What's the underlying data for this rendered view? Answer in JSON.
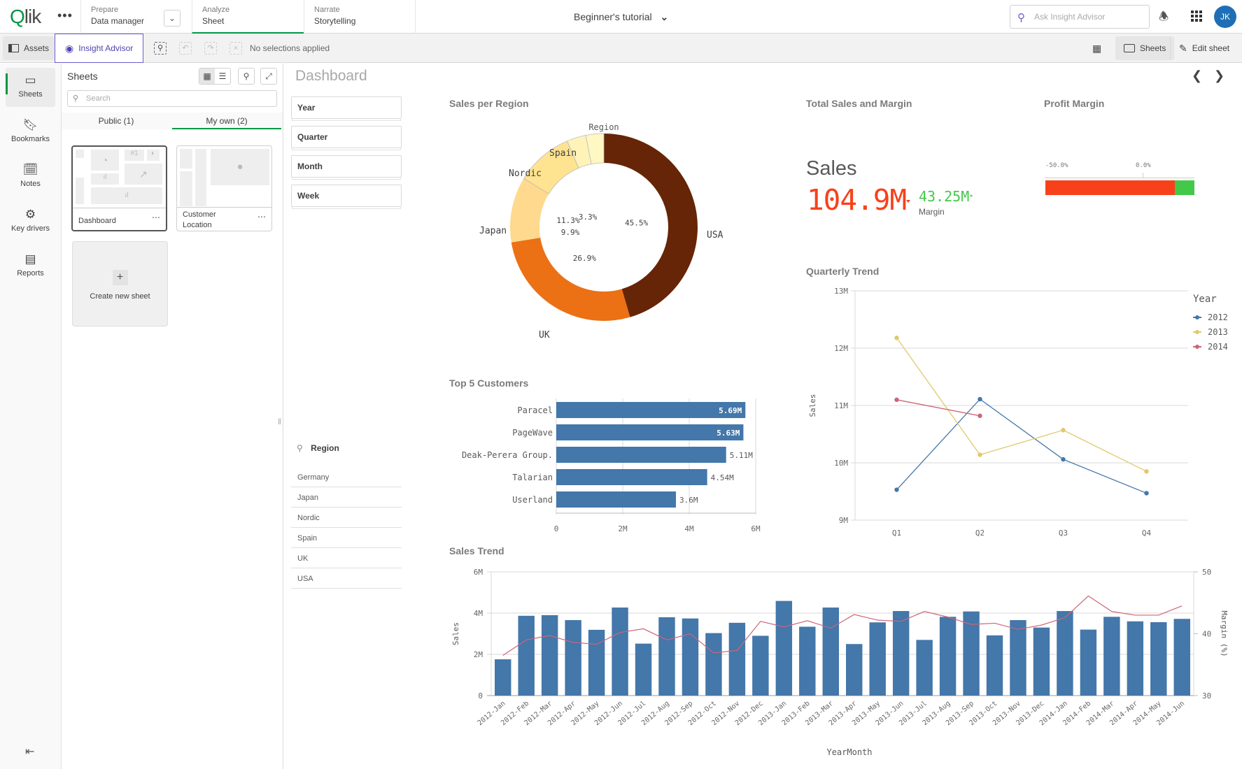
{
  "topbar": {
    "logo": "Qlik",
    "more_label": "•••",
    "nav": [
      {
        "small": "Prepare",
        "big": "Data manager"
      },
      {
        "small": "Analyze",
        "big": "Sheet",
        "active": true
      },
      {
        "small": "Narrate",
        "big": "Storytelling"
      }
    ],
    "app_title": "Beginner's tutorial",
    "search_placeholder": "Ask Insight Advisor",
    "avatar_initials": "JK"
  },
  "toolbar": {
    "assets_label": "Assets",
    "insight_label": "Insight Advisor",
    "no_selections": "No selections applied",
    "sheets_label": "Sheets",
    "edit_label": "Edit sheet"
  },
  "rail": {
    "items": [
      {
        "label": "Sheets",
        "icon": "sheets-icon",
        "active": true
      },
      {
        "label": "Bookmarks",
        "icon": "bookmark-icon"
      },
      {
        "label": "Notes",
        "icon": "notes-icon"
      },
      {
        "label": "Key drivers",
        "icon": "key-drivers-icon"
      },
      {
        "label": "Reports",
        "icon": "reports-icon"
      }
    ]
  },
  "panel": {
    "title": "Sheets",
    "search_placeholder": "Search",
    "tabs": [
      {
        "label": "Public (1)"
      },
      {
        "label": "My own (2)",
        "active": true
      }
    ],
    "cards": [
      {
        "label": "Dashboard",
        "selected": true
      },
      {
        "label": "Customer Location"
      }
    ],
    "create_label": "Create new sheet"
  },
  "main": {
    "title": "Dashboard",
    "filters": [
      "Year",
      "Quarter",
      "Month",
      "Week"
    ],
    "region_filter": {
      "title": "Region",
      "items": [
        "Germany",
        "Japan",
        "Nordic",
        "Spain",
        "UK",
        "USA"
      ]
    },
    "kpi": {
      "title": "Total Sales and Margin",
      "label": "Sales",
      "value": "104.9M",
      "secondary_value": "43.25M",
      "secondary_label": "Margin",
      "value_color": "#f8411b",
      "secondary_color": "#44c84a"
    },
    "gauge": {
      "title": "Profit Margin",
      "ticks": [
        "-50.0%",
        "0.0%"
      ],
      "range": [
        -50,
        25
      ],
      "red_to": 15,
      "colors": {
        "negative": "#f8411b",
        "positive": "#44c84a"
      }
    }
  },
  "chart_data": [
    {
      "type": "pie",
      "title": "Sales per Region",
      "legend_title": "Region",
      "categories": [
        "USA",
        "UK",
        "Japan",
        "Nordic",
        "Spain",
        "Germany"
      ],
      "values": [
        45.5,
        26.9,
        11.3,
        9.9,
        3.3,
        3.1
      ],
      "labels": [
        "45.5%",
        "26.9%",
        "11.3%",
        "9.9%",
        "3.3%",
        ""
      ],
      "colors": [
        "#662506",
        "#ec7014",
        "#fed98e",
        "#fee391",
        "#fff3b8",
        "#fff7c4"
      ]
    },
    {
      "type": "bar",
      "orientation": "horizontal",
      "title": "Top 5 Customers",
      "categories": [
        "Paracel",
        "PageWave",
        "Deak-Perera Group.",
        "Talarian",
        "Userland"
      ],
      "values": [
        5.69,
        5.63,
        5.11,
        4.54,
        3.6
      ],
      "labels": [
        "5.69M",
        "5.63M",
        "5.11M",
        "4.54M",
        "3.6M"
      ],
      "xticks": [
        "0",
        "2M",
        "4M",
        "6M"
      ],
      "xlim": [
        0,
        6
      ],
      "unit": "M",
      "color": "#4477aa"
    },
    {
      "type": "line",
      "title": "Quarterly Trend",
      "ylabel": "Sales",
      "categories": [
        "Q1",
        "Q2",
        "Q3",
        "Q4"
      ],
      "yticks": [
        "9M",
        "10M",
        "11M",
        "12M",
        "13M"
      ],
      "ylim": [
        9,
        13
      ],
      "legend_title": "Year",
      "legend": "right",
      "series": [
        {
          "name": "2012",
          "color": "#4477aa",
          "values": [
            9.53,
            11.11,
            10.06,
            9.47
          ]
        },
        {
          "name": "2013",
          "color": "#e1c86d",
          "values": [
            12.18,
            10.14,
            10.57,
            9.85
          ]
        },
        {
          "name": "2014",
          "color": "#cc6677",
          "values": [
            11.1,
            10.82,
            null,
            null
          ]
        }
      ]
    },
    {
      "type": "bar",
      "title": "Sales Trend",
      "xlabel": "YearMonth",
      "ylabel": "Sales",
      "y2label": "Margin (%)",
      "yticks": [
        "0",
        "2M",
        "4M",
        "6M"
      ],
      "ylim": [
        0,
        6
      ],
      "y2ticks": [
        "30",
        "40",
        "50"
      ],
      "y2lim": [
        30,
        50
      ],
      "categories": [
        "2012-Jan",
        "2012-Feb",
        "2012-Mar",
        "2012-Apr",
        "2012-May",
        "2012-Jun",
        "2012-Jul",
        "2012-Aug",
        "2012-Sep",
        "2012-Oct",
        "2012-Nov",
        "2012-Dec",
        "2013-Jan",
        "2013-Feb",
        "2013-Mar",
        "2013-Apr",
        "2013-May",
        "2013-Jun",
        "2013-Jul",
        "2013-Aug",
        "2013-Sep",
        "2013-Oct",
        "2013-Nov",
        "2013-Dec",
        "2014-Jan",
        "2014-Feb",
        "2014-Mar",
        "2014-Apr",
        "2014-May",
        "2014-Jun"
      ],
      "series": [
        {
          "name": "Sales",
          "type": "bar",
          "color": "#4477aa",
          "values": [
            1.76,
            3.87,
            3.9,
            3.66,
            3.19,
            4.27,
            2.52,
            3.8,
            3.74,
            3.03,
            3.53,
            2.9,
            4.59,
            3.34,
            4.27,
            2.5,
            3.55,
            4.1,
            2.7,
            3.82,
            4.08,
            2.92,
            3.66,
            3.3,
            4.1,
            3.2,
            3.82,
            3.6,
            3.56,
            3.72
          ]
        },
        {
          "name": "Margin (%)",
          "type": "line",
          "axis": "right",
          "color": "#cc6677",
          "values": [
            36.5,
            39.0,
            39.7,
            38.6,
            38.3,
            40.2,
            40.8,
            39.0,
            40.0,
            36.9,
            37.3,
            42.0,
            41.1,
            42.1,
            40.9,
            43.1,
            42.2,
            42.0,
            43.6,
            42.7,
            41.5,
            41.7,
            40.7,
            41.4,
            42.6,
            46.1,
            43.6,
            43.0,
            43.0,
            44.5
          ]
        }
      ]
    }
  ]
}
